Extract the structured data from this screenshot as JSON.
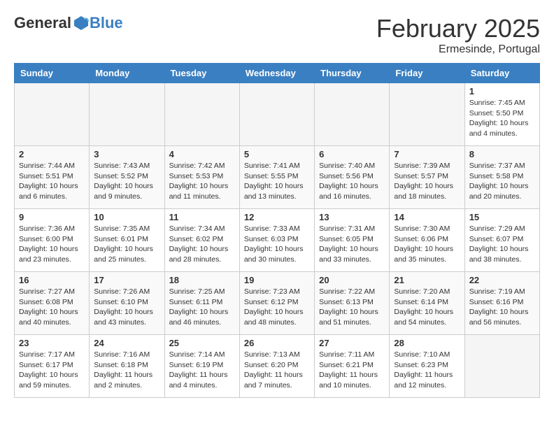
{
  "header": {
    "logo_general": "General",
    "logo_blue": "Blue",
    "month": "February 2025",
    "location": "Ermesinde, Portugal"
  },
  "weekdays": [
    "Sunday",
    "Monday",
    "Tuesday",
    "Wednesday",
    "Thursday",
    "Friday",
    "Saturday"
  ],
  "weeks": [
    [
      {
        "day": "",
        "info": ""
      },
      {
        "day": "",
        "info": ""
      },
      {
        "day": "",
        "info": ""
      },
      {
        "day": "",
        "info": ""
      },
      {
        "day": "",
        "info": ""
      },
      {
        "day": "",
        "info": ""
      },
      {
        "day": "1",
        "info": "Sunrise: 7:45 AM\nSunset: 5:50 PM\nDaylight: 10 hours and 4 minutes."
      }
    ],
    [
      {
        "day": "2",
        "info": "Sunrise: 7:44 AM\nSunset: 5:51 PM\nDaylight: 10 hours and 6 minutes."
      },
      {
        "day": "3",
        "info": "Sunrise: 7:43 AM\nSunset: 5:52 PM\nDaylight: 10 hours and 9 minutes."
      },
      {
        "day": "4",
        "info": "Sunrise: 7:42 AM\nSunset: 5:53 PM\nDaylight: 10 hours and 11 minutes."
      },
      {
        "day": "5",
        "info": "Sunrise: 7:41 AM\nSunset: 5:55 PM\nDaylight: 10 hours and 13 minutes."
      },
      {
        "day": "6",
        "info": "Sunrise: 7:40 AM\nSunset: 5:56 PM\nDaylight: 10 hours and 16 minutes."
      },
      {
        "day": "7",
        "info": "Sunrise: 7:39 AM\nSunset: 5:57 PM\nDaylight: 10 hours and 18 minutes."
      },
      {
        "day": "8",
        "info": "Sunrise: 7:37 AM\nSunset: 5:58 PM\nDaylight: 10 hours and 20 minutes."
      }
    ],
    [
      {
        "day": "9",
        "info": "Sunrise: 7:36 AM\nSunset: 6:00 PM\nDaylight: 10 hours and 23 minutes."
      },
      {
        "day": "10",
        "info": "Sunrise: 7:35 AM\nSunset: 6:01 PM\nDaylight: 10 hours and 25 minutes."
      },
      {
        "day": "11",
        "info": "Sunrise: 7:34 AM\nSunset: 6:02 PM\nDaylight: 10 hours and 28 minutes."
      },
      {
        "day": "12",
        "info": "Sunrise: 7:33 AM\nSunset: 6:03 PM\nDaylight: 10 hours and 30 minutes."
      },
      {
        "day": "13",
        "info": "Sunrise: 7:31 AM\nSunset: 6:05 PM\nDaylight: 10 hours and 33 minutes."
      },
      {
        "day": "14",
        "info": "Sunrise: 7:30 AM\nSunset: 6:06 PM\nDaylight: 10 hours and 35 minutes."
      },
      {
        "day": "15",
        "info": "Sunrise: 7:29 AM\nSunset: 6:07 PM\nDaylight: 10 hours and 38 minutes."
      }
    ],
    [
      {
        "day": "16",
        "info": "Sunrise: 7:27 AM\nSunset: 6:08 PM\nDaylight: 10 hours and 40 minutes."
      },
      {
        "day": "17",
        "info": "Sunrise: 7:26 AM\nSunset: 6:10 PM\nDaylight: 10 hours and 43 minutes."
      },
      {
        "day": "18",
        "info": "Sunrise: 7:25 AM\nSunset: 6:11 PM\nDaylight: 10 hours and 46 minutes."
      },
      {
        "day": "19",
        "info": "Sunrise: 7:23 AM\nSunset: 6:12 PM\nDaylight: 10 hours and 48 minutes."
      },
      {
        "day": "20",
        "info": "Sunrise: 7:22 AM\nSunset: 6:13 PM\nDaylight: 10 hours and 51 minutes."
      },
      {
        "day": "21",
        "info": "Sunrise: 7:20 AM\nSunset: 6:14 PM\nDaylight: 10 hours and 54 minutes."
      },
      {
        "day": "22",
        "info": "Sunrise: 7:19 AM\nSunset: 6:16 PM\nDaylight: 10 hours and 56 minutes."
      }
    ],
    [
      {
        "day": "23",
        "info": "Sunrise: 7:17 AM\nSunset: 6:17 PM\nDaylight: 10 hours and 59 minutes."
      },
      {
        "day": "24",
        "info": "Sunrise: 7:16 AM\nSunset: 6:18 PM\nDaylight: 11 hours and 2 minutes."
      },
      {
        "day": "25",
        "info": "Sunrise: 7:14 AM\nSunset: 6:19 PM\nDaylight: 11 hours and 4 minutes."
      },
      {
        "day": "26",
        "info": "Sunrise: 7:13 AM\nSunset: 6:20 PM\nDaylight: 11 hours and 7 minutes."
      },
      {
        "day": "27",
        "info": "Sunrise: 7:11 AM\nSunset: 6:21 PM\nDaylight: 11 hours and 10 minutes."
      },
      {
        "day": "28",
        "info": "Sunrise: 7:10 AM\nSunset: 6:23 PM\nDaylight: 11 hours and 12 minutes."
      },
      {
        "day": "",
        "info": ""
      }
    ]
  ]
}
